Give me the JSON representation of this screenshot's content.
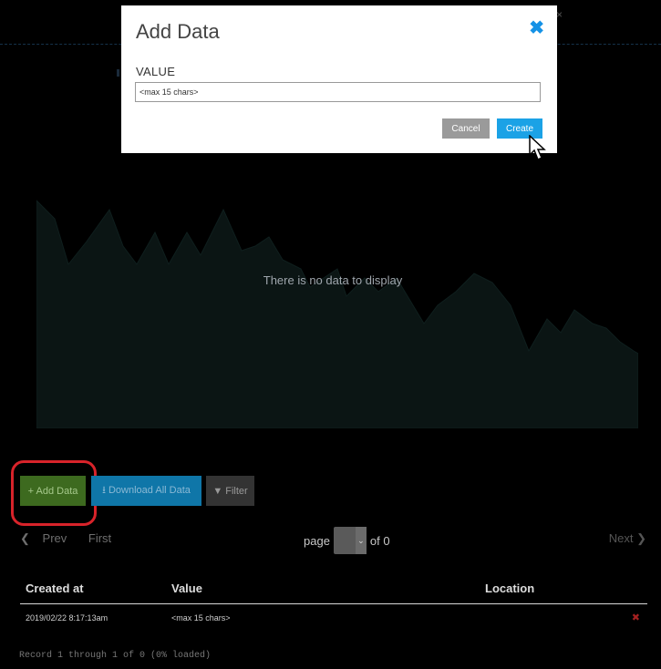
{
  "modal": {
    "title": "Add Data",
    "close_icon": "close-icon",
    "field_label": "VALUE",
    "input_value": "<max 15 chars>",
    "cancel_label": "Cancel",
    "create_label": "Create",
    "accent_color": "#1ba2e6"
  },
  "chart": {
    "empty_message": "There is no data to display"
  },
  "actions": {
    "add_label": "+ Add Data",
    "download_label": "Download All Data",
    "download_icon": "download-icon",
    "filter_label": "Filter",
    "filter_icon": "filter-icon",
    "add_color": "#3d6a1f",
    "download_color": "#0f76a8",
    "highlight_color": "#d8232a"
  },
  "pagination": {
    "prev_label": "Prev",
    "first_label": "First",
    "page_label": "page",
    "of_label": "of 0",
    "next_label": "Next"
  },
  "table": {
    "headers": [
      "Created at",
      "Value",
      "Location"
    ],
    "rows": [
      {
        "created_at": "2019/02/22 8:17:13am",
        "value": "<max 15 chars>",
        "location": ""
      }
    ],
    "delete_icon": "delete-icon"
  },
  "status": {
    "record_text": "Record 1 through 1 of 0 (0% loaded)"
  }
}
